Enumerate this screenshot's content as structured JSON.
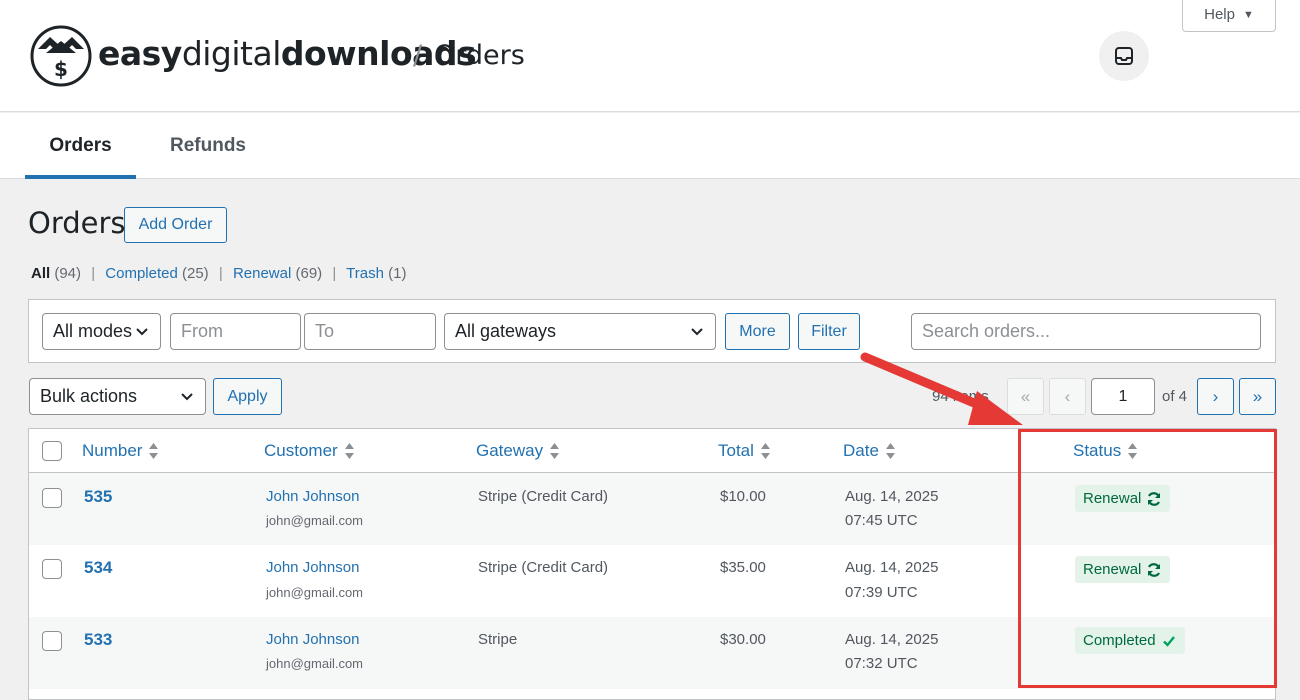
{
  "header": {
    "brand_bold_1": "easy",
    "brand_light": "digital",
    "brand_bold_2": "downloads",
    "separator": "/",
    "page": "Orders",
    "help_label": "Help",
    "logo_icon": "edd-logo-icon",
    "inbox_icon": "inbox-icon"
  },
  "tabs": [
    {
      "label": "Orders",
      "active": true
    },
    {
      "label": "Refunds",
      "active": false
    }
  ],
  "title": "Orders",
  "add_order_label": "Add Order",
  "views": {
    "all": "All",
    "all_count": "(94)",
    "completed": "Completed",
    "completed_count": "(25)",
    "renewal": "Renewal",
    "renewal_count": "(69)",
    "trash": "Trash",
    "trash_count": "(1)",
    "sep": "|"
  },
  "filters": {
    "modes": "All modes",
    "from_placeholder": "From",
    "to_placeholder": "To",
    "gateways": "All gateways",
    "more_label": "More",
    "filter_label": "Filter",
    "search_placeholder": "Search orders..."
  },
  "bulk": {
    "actions": "Bulk actions",
    "apply_label": "Apply"
  },
  "pagination": {
    "items_text": "94 items",
    "first": "«",
    "prev": "‹",
    "current_page": "1",
    "of_text": "of 4",
    "next": "›",
    "last": "»"
  },
  "columns": [
    "Number",
    "Customer",
    "Gateway",
    "Total",
    "Date",
    "Status"
  ],
  "rows": [
    {
      "number": "535",
      "customer": "John Johnson",
      "email": "john@gmail.com",
      "gateway": "Stripe (Credit Card)",
      "total": "$10.00",
      "date": "Aug. 14, 2025",
      "time": "07:45 UTC",
      "status": "Renewal",
      "status_icon": "renewal-icon"
    },
    {
      "number": "534",
      "customer": "John Johnson",
      "email": "john@gmail.com",
      "gateway": "Stripe (Credit Card)",
      "total": "$35.00",
      "date": "Aug. 14, 2025",
      "time": "07:39 UTC",
      "status": "Renewal",
      "status_icon": "renewal-icon"
    },
    {
      "number": "533",
      "customer": "John Johnson",
      "email": "john@gmail.com",
      "gateway": "Stripe",
      "total": "$30.00",
      "date": "Aug. 14, 2025",
      "time": "07:32 UTC",
      "status": "Completed",
      "status_icon": "check-icon"
    }
  ],
  "colors": {
    "accent": "#2271b1",
    "status_bg": "#e4f3ea",
    "status_text": "#00693c",
    "annotation": "#e53935"
  }
}
